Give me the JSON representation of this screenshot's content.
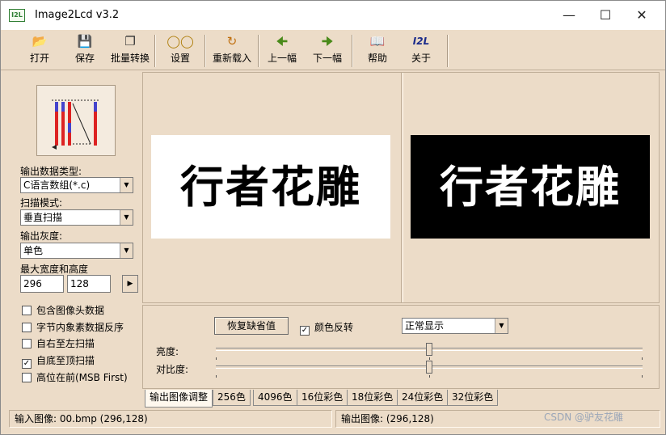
{
  "window": {
    "icon_text": "I2L",
    "title": "Image2Lcd v3.2"
  },
  "toolbar": {
    "open": "打开",
    "save": "保存",
    "batch": "批量转换",
    "settings": "设置",
    "reload": "重新载入",
    "prev": "上一幅",
    "next": "下一幅",
    "help": "帮助",
    "about": "关于"
  },
  "left": {
    "output_type_label": "输出数据类型:",
    "output_type_value": "C语言数组(*.c)",
    "scan_mode_label": "扫描模式:",
    "scan_mode_value": "垂直扫描",
    "gray_label": "输出灰度:",
    "gray_value": "单色",
    "size_label": "最大宽度和高度",
    "width": "296",
    "height": "128",
    "options": [
      {
        "label": "包含图像头数据",
        "checked": false
      },
      {
        "label": "字节内象素数据反序",
        "checked": false
      },
      {
        "label": "自右至左扫描",
        "checked": false
      },
      {
        "label": "自底至顶扫描",
        "checked": true
      },
      {
        "label": "高位在前(MSB First)",
        "checked": false
      }
    ]
  },
  "preview": {
    "input_text": "行者花雕",
    "output_text": "行者花雕"
  },
  "adjust": {
    "restore_button": "恢复缺省值",
    "invert_label": "颜色反转",
    "invert_checked": true,
    "display_mode": "正常显示",
    "brightness_label": "亮度:",
    "brightness": 0.5,
    "contrast_label": "对比度:",
    "contrast": 0.5
  },
  "tabs": [
    "输出图像调整",
    "256色",
    "4096色",
    "16位彩色",
    "18位彩色",
    "24位彩色",
    "32位彩色"
  ],
  "status": {
    "input": "输入图像: 00.bmp (296,128)",
    "output": "输出图像: (296,128)"
  },
  "watermark": "CSDN @驴友花雕"
}
